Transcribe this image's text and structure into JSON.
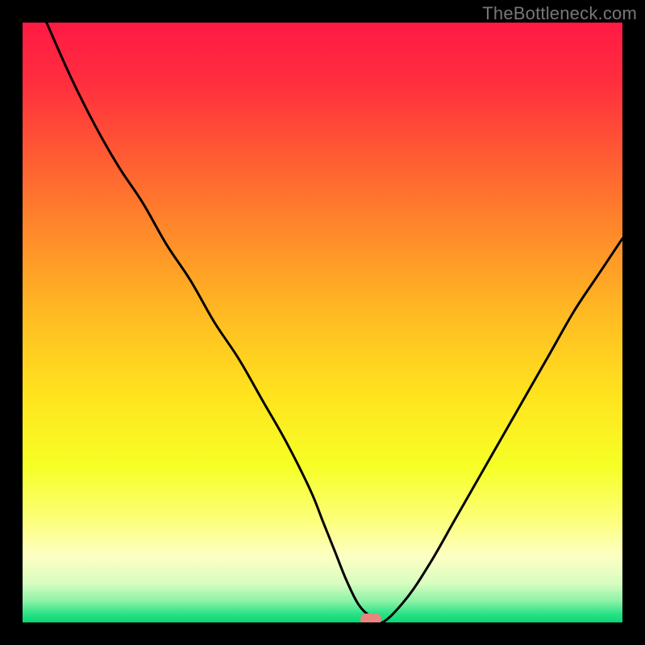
{
  "watermark": "TheBottleneck.com",
  "colors": {
    "gradient_stops": [
      {
        "offset": 0.0,
        "color": "#ff1a44"
      },
      {
        "offset": 0.1,
        "color": "#ff2e3e"
      },
      {
        "offset": 0.22,
        "color": "#ff5a33"
      },
      {
        "offset": 0.35,
        "color": "#ff8a2a"
      },
      {
        "offset": 0.5,
        "color": "#ffbf22"
      },
      {
        "offset": 0.62,
        "color": "#ffe31e"
      },
      {
        "offset": 0.74,
        "color": "#f6ff26"
      },
      {
        "offset": 0.83,
        "color": "#fcff7a"
      },
      {
        "offset": 0.89,
        "color": "#fdffc4"
      },
      {
        "offset": 0.935,
        "color": "#d8fdc0"
      },
      {
        "offset": 0.965,
        "color": "#8af2a6"
      },
      {
        "offset": 0.985,
        "color": "#2de287"
      },
      {
        "offset": 1.0,
        "color": "#07d874"
      }
    ],
    "curve": "#000000",
    "marker": "#e9847f",
    "frame": "#000000"
  },
  "chart_data": {
    "type": "line",
    "title": "",
    "xlabel": "",
    "ylabel": "",
    "xlim": [
      0,
      100
    ],
    "ylim": [
      0,
      100
    ],
    "grid": false,
    "series": [
      {
        "name": "bottleneck-curve",
        "x": [
          4,
          8,
          12,
          16,
          20,
          24,
          28,
          32,
          36,
          40,
          44,
          48,
          50,
          52,
          54,
          56,
          58,
          60,
          64,
          68,
          72,
          76,
          80,
          84,
          88,
          92,
          96,
          100
        ],
        "y": [
          100,
          91,
          83,
          76,
          70,
          63,
          57,
          50,
          44,
          37,
          30,
          22,
          17,
          12,
          7,
          3,
          1,
          0,
          4,
          10,
          17,
          24,
          31,
          38,
          45,
          52,
          58,
          64
        ]
      }
    ],
    "annotations": [
      {
        "name": "optimal-marker",
        "x": 58,
        "y": 0.5,
        "shape": "rounded-rect"
      }
    ]
  }
}
